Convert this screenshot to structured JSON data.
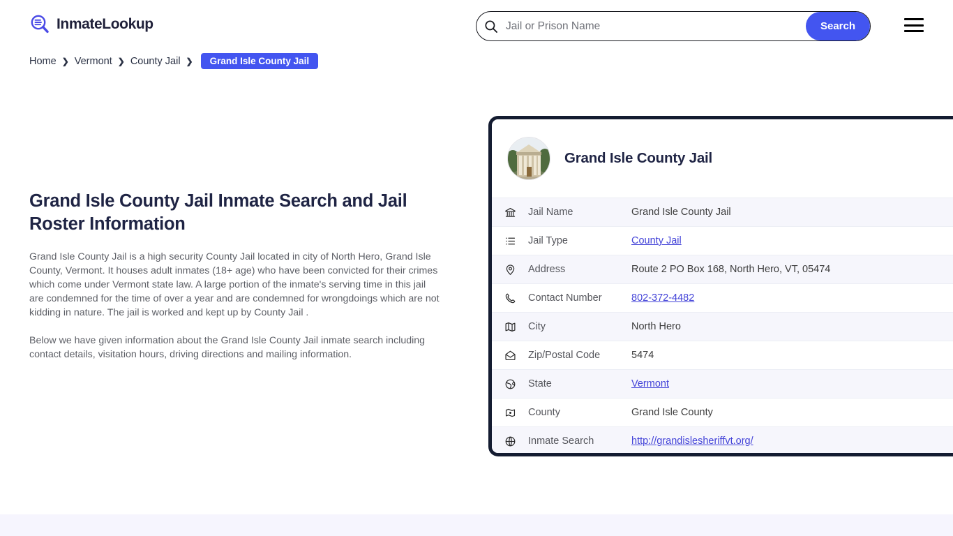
{
  "brand": {
    "name": "InmateLookup",
    "logo_icon": "magnifier-list-icon",
    "accent_color": "#4355f0",
    "dark_color": "#141c31"
  },
  "search": {
    "placeholder": "Jail or Prison Name",
    "value": "",
    "button_label": "Search",
    "icon": "search-icon"
  },
  "menu": {
    "icon": "hamburger-menu-icon"
  },
  "breadcrumb": {
    "items": [
      {
        "label": "Home"
      },
      {
        "label": "Vermont"
      },
      {
        "label": "County Jail"
      }
    ],
    "separator": "❯",
    "current": "Grand Isle County Jail"
  },
  "main": {
    "title": "Grand Isle County Jail Inmate Search and Jail Roster Information",
    "paragraph_1": "Grand Isle County Jail is a high security County Jail located in city of North Hero, Grand Isle County, Vermont. It houses adult inmates (18+ age) who have been convicted for their crimes which come under Vermont state law. A large portion of the inmate's serving time in this jail are condemned for the time of over a year and are condemned for wrongdoings which are not kidding in nature. The jail is worked and kept up by County Jail .",
    "paragraph_2": "Below we have given information about the Grand Isle County Jail inmate search including contact details, visitation hours, driving directions and mailing information."
  },
  "card": {
    "title": "Grand Isle County Jail",
    "avatar_icon": "courthouse-photo",
    "rows": [
      {
        "icon": "bank-building-icon",
        "label": "Jail Name",
        "value": "Grand Isle County Jail",
        "is_link": false
      },
      {
        "icon": "list-icon",
        "label": "Jail Type",
        "value": "County Jail",
        "is_link": true
      },
      {
        "icon": "location-pin-icon",
        "label": "Address",
        "value": "Route 2 PO Box 168, North Hero, VT, 05474",
        "is_link": false
      },
      {
        "icon": "phone-icon",
        "label": "Contact Number",
        "value": "802-372-4482",
        "is_link": true
      },
      {
        "icon": "map-icon",
        "label": "City",
        "value": "North Hero",
        "is_link": false
      },
      {
        "icon": "envelope-icon",
        "label": "Zip/Postal Code",
        "value": "5474",
        "is_link": false
      },
      {
        "icon": "globe-icon",
        "label": "State",
        "value": "Vermont",
        "is_link": true
      },
      {
        "icon": "map-pin-icon",
        "label": "County",
        "value": "Grand Isle County",
        "is_link": false
      },
      {
        "icon": "web-globe-icon",
        "label": "Inmate Search",
        "value": "http://grandislesheriffvt.org/",
        "is_link": true
      }
    ]
  }
}
